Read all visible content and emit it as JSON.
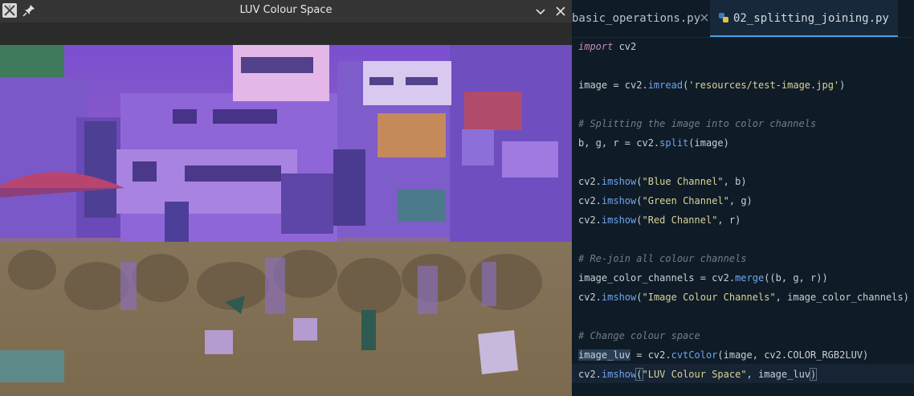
{
  "window": {
    "title": "LUV Colour Space",
    "icons": [
      "app-icon",
      "pin-icon",
      "minimize-icon",
      "close-icon"
    ]
  },
  "editor": {
    "tabs": [
      {
        "label": "basic_operations.py",
        "active": false
      },
      {
        "label": "02_splitting_joining.py",
        "active": true
      }
    ],
    "colors": {
      "keyword": "#c586c0",
      "function": "#6ea5f0",
      "string": "#d7d39a",
      "comment": "#6f7f8c",
      "text": "#c8d0d8",
      "accent": "#4a9ee0"
    },
    "code": {
      "l1_kw": "import",
      "l1_rest": " cv2",
      "l2_a": "image = cv2.",
      "l2_fn": "imread",
      "l2_b": "(",
      "l2_str": "'resources/test-image.jpg'",
      "l2_c": ")",
      "l3": "# Splitting the image into color channels",
      "l4_a": "b, g, r = cv2.",
      "l4_fn": "split",
      "l4_b": "(image)",
      "l5_a": "cv2.",
      "l5_fn": "imshow",
      "l5_b": "(",
      "l5_str": "\"Blue Channel\"",
      "l5_c": ", b)",
      "l6_a": "cv2.",
      "l6_fn": "imshow",
      "l6_b": "(",
      "l6_str": "\"Green Channel\"",
      "l6_c": ", g)",
      "l7_a": "cv2.",
      "l7_fn": "imshow",
      "l7_b": "(",
      "l7_str": "\"Red Channel\"",
      "l7_c": ", r)",
      "l8": "# Re-join all colour channels",
      "l9_a": "image_color_channels = cv2.",
      "l9_fn": "merge",
      "l9_b": "((b, g, r))",
      "l10_a": "cv2.",
      "l10_fn": "imshow",
      "l10_b": "(",
      "l10_str": "\"Image Colour Channels\"",
      "l10_c": ", image_color_channels)",
      "l11": "# Change colour space",
      "l12_hl": "image_luv",
      "l12_a": " = cv2.",
      "l12_fn": "cvtColor",
      "l12_b": "(image, cv2.COLOR_RGB2LUV)",
      "l13_a": "cv2.",
      "l13_fn": "imshow",
      "l13_open": "(",
      "l13_str": "\"LUV Colour Space\"",
      "l13_b": ", image_luv",
      "l13_close": ")"
    }
  }
}
